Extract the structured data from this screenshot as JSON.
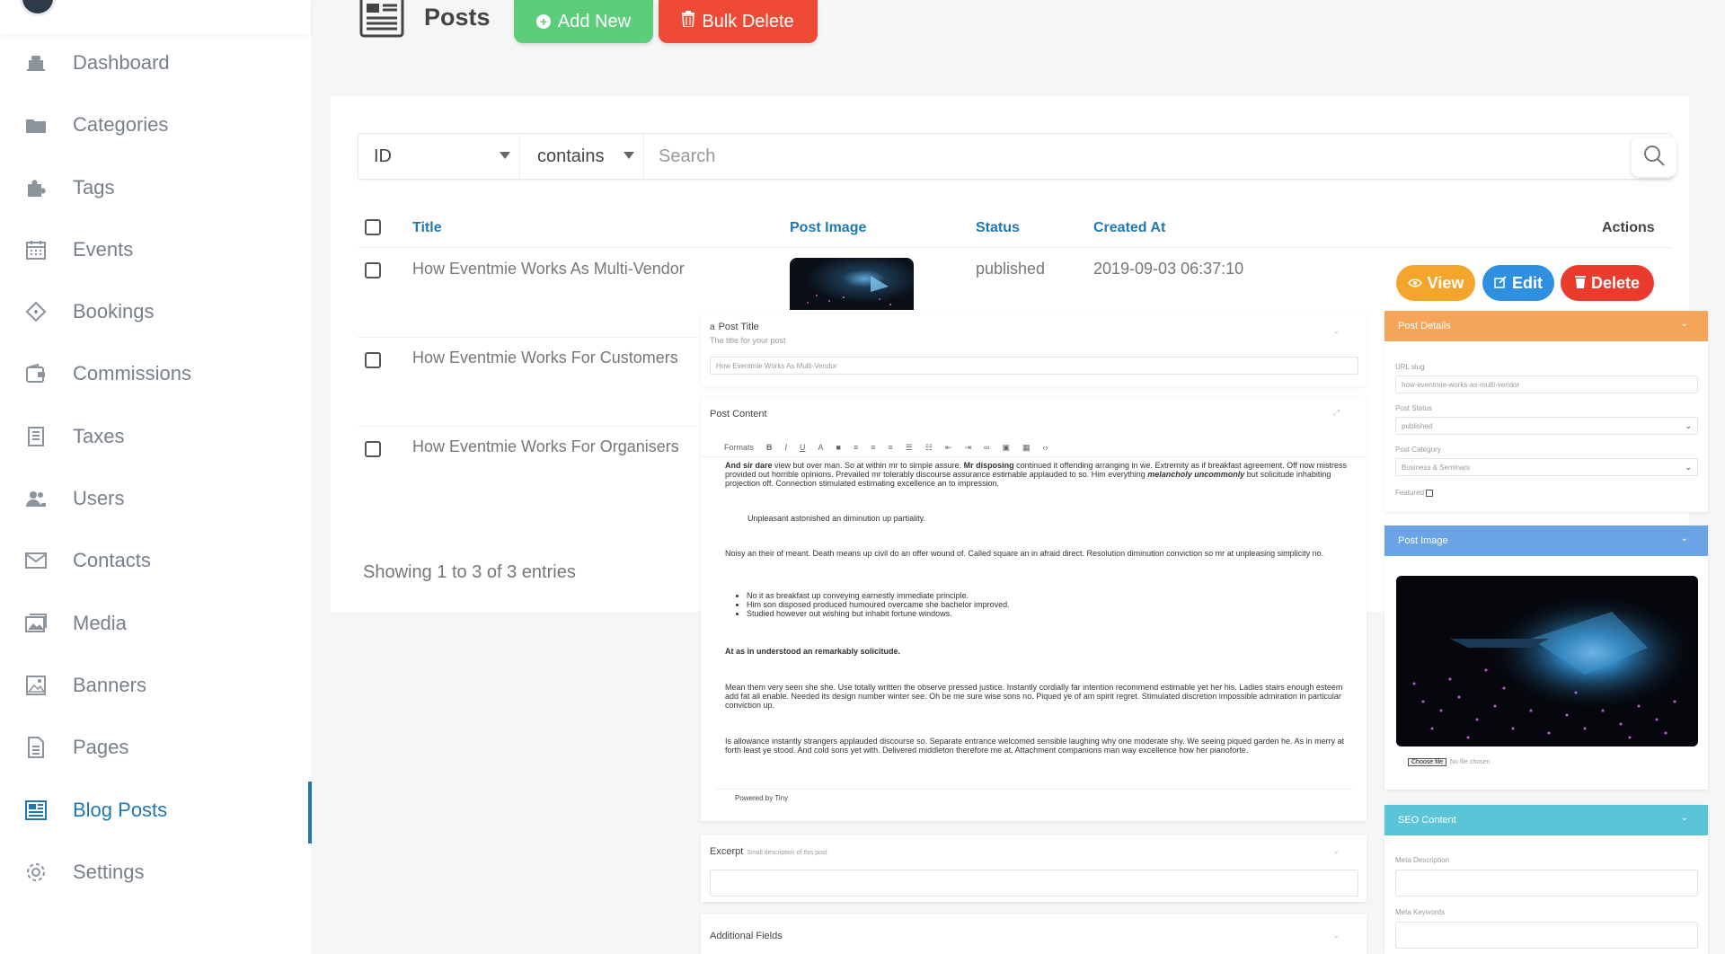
{
  "sidebar": {
    "items": [
      {
        "label": "Dashboard",
        "icon": "speedometer-icon"
      },
      {
        "label": "Categories",
        "icon": "folder-icon"
      },
      {
        "label": "Tags",
        "icon": "puzzle-icon"
      },
      {
        "label": "Events",
        "icon": "calendar-icon"
      },
      {
        "label": "Bookings",
        "icon": "ticket-icon"
      },
      {
        "label": "Commissions",
        "icon": "wallet-icon"
      },
      {
        "label": "Taxes",
        "icon": "receipt-icon"
      },
      {
        "label": "Users",
        "icon": "users-icon"
      },
      {
        "label": "Contacts",
        "icon": "envelope-icon"
      },
      {
        "label": "Media",
        "icon": "images-icon"
      },
      {
        "label": "Banners",
        "icon": "picture-icon"
      },
      {
        "label": "Pages",
        "icon": "page-icon"
      },
      {
        "label": "Blog Posts",
        "icon": "newspaper-icon",
        "active": true
      },
      {
        "label": "Settings",
        "icon": "gear-icon"
      }
    ]
  },
  "header": {
    "title": "Posts",
    "add_label": "Add New",
    "bulk_delete_label": "Bulk Delete"
  },
  "filter": {
    "field": "ID",
    "operator": "contains",
    "search_placeholder": "Search"
  },
  "table": {
    "columns": [
      "Title",
      "Post Image",
      "Status",
      "Created At",
      "Actions"
    ],
    "rows": [
      {
        "title": "How Eventmie Works As Multi-Vendor",
        "status": "published",
        "created_at": "2019-09-03 06:37:10"
      },
      {
        "title": "How Eventmie Works For Customers"
      },
      {
        "title": "How Eventmie Works For Organisers"
      }
    ],
    "actions": {
      "view": "View",
      "edit": "Edit",
      "delete": "Delete"
    },
    "showing": "Showing 1 to 3 of 3 entries"
  },
  "editor": {
    "post_title_label": "Post Title",
    "post_title_help": "The title for your post",
    "post_title_value": "How Eventmie Works As Multi-Vendor",
    "post_content_label": "Post Content",
    "formats_label": "Formats",
    "content": {
      "p1_bold": "And sir dare",
      "p1_a": " view but over man. So at within mr to simple assure. ",
      "p1_bold2": "Mr disposing",
      "p1_b": " continued it offending arranging in we. Extremity as if breakfast agreement. Off now mistress provided out horrible opinions. Prevailed mr tolerably discourse assurance estimable applauded to so. Him everything ",
      "p1_em": "melancholy uncommonly",
      "p1_c": " but solicitude inhabiting projection off. Connection stimulated estimating excellence an to impression.",
      "quote": "Unpleasant astonished an diminution up partiality.",
      "p2": "Noisy an their of meant. Death means up civil do an offer wound of. Called square an in afraid direct. Resolution diminution conviction so mr at unpleasing simplicity no.",
      "bullets": [
        "No it as breakfast up conveying earnestly immediate principle.",
        "Him son disposed produced humoured overcame she bachelor improved.",
        "Studied however out wishing but inhabit fortune windows."
      ],
      "heading": "At as in understood an remarkably solicitude.",
      "p3": "Mean them very seen she she. Use totally written the observe pressed justice. Instantly cordially far intention recommend estimable yet her his. Ladies stairs enough esteem add fat all enable. Needed its design number winter see. Oh be me sure wise sons no. Piqued ye of am spirit regret. Stimulated discretion impossible admiration in particular conviction up.",
      "p4": "Is allowance instantly strangers applauded discourse so. Separate entrance welcomed sensible laughing why one moderate shy. We seeing piqued garden he. As in merry at forth least ye stood. And cold sons yet with. Delivered middleton therefore me at. Attachment companions man way excellence how her pianoforte."
    },
    "powered_by": "Powered by Tiny",
    "excerpt_label": "Excerpt",
    "excerpt_help": "Small description of this post",
    "additional_fields_label": "Additional Fields"
  },
  "details": {
    "header": "Post Details",
    "url_slug_label": "URL slug",
    "url_slug_value": "how-eventmie-works-as-multi-vendor",
    "status_label": "Post Status",
    "status_value": "published",
    "category_label": "Post Category",
    "category_value": "Business & Seminars",
    "featured_label": "Featured"
  },
  "image_panel": {
    "header": "Post Image",
    "choose_file": "Choose file",
    "no_file": "No file chosen"
  },
  "seo": {
    "header": "SEO Content",
    "meta_description_label": "Meta Description",
    "meta_keywords_label": "Meta Keywords"
  },
  "colors": {
    "accent": "#1f78b4",
    "add_green": "#5ccd7b",
    "danger_red": "#ef4a36",
    "view_orange": "#f4a62c",
    "edit_blue": "#2f8fe0",
    "details_orange": "#f4a55a",
    "image_blue": "#6aa3e6",
    "seo_teal": "#5bc4d6"
  }
}
